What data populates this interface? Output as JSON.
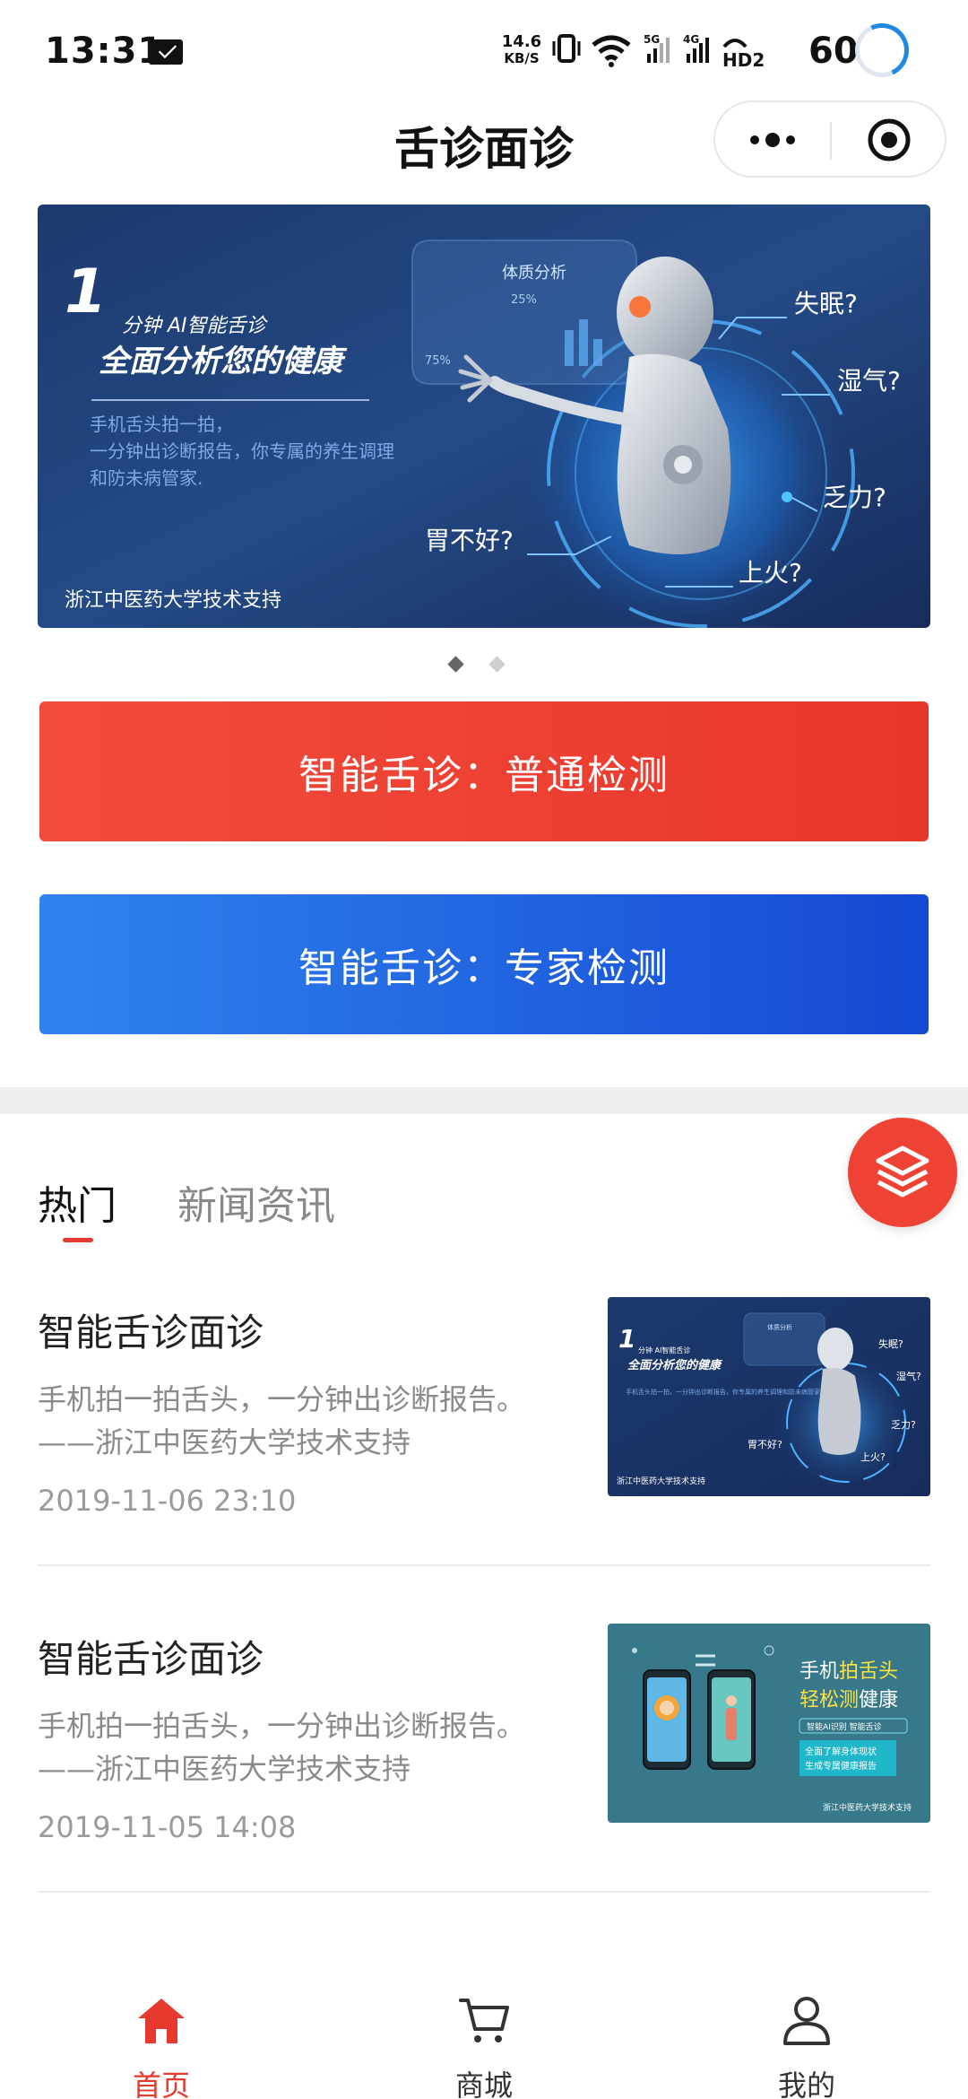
{
  "status_bar": {
    "time": "13:31",
    "net_speed_value": "14.6",
    "net_speed_unit": "KB/S",
    "signal_5g": "5G",
    "signal_4g": "4G",
    "hd_label": "HD2",
    "battery": "60",
    "icons": [
      "mail-icon",
      "vibrate-icon",
      "wifi-icon",
      "signal-5g-icon",
      "signal-4g-icon",
      "hd-icon",
      "battery-ring-icon"
    ]
  },
  "header": {
    "title": "舌诊面诊",
    "capsule_icons": [
      "more-dots-icon",
      "close-target-icon"
    ]
  },
  "banner": {
    "badge_number": "1",
    "line1": "分钟 AI智能舌诊",
    "line2": "全面分析您的健康",
    "desc1": "手机舌头拍一拍，",
    "desc2": "一分钟出诊断报告，你专属的养生调理",
    "desc3": "和防未病管家.",
    "panel_title": "体质分析",
    "panel_pct1": "25%",
    "panel_pct2": "75%",
    "q1": "失眠?",
    "q2": "湿气?",
    "q3": "乏力?",
    "q4": "上火?",
    "q5": "胃不好?",
    "footer": "浙江中医药大学技术支持",
    "pages": 2,
    "active_page": 1
  },
  "actions": {
    "normal_label": "智能舌诊：普通检测",
    "expert_label": "智能舌诊：专家检测"
  },
  "fab": {
    "icon": "layers-icon"
  },
  "tabs": [
    {
      "label": "热门",
      "active": true
    },
    {
      "label": "新闻资讯",
      "active": false
    }
  ],
  "articles": [
    {
      "title": "智能舌诊面诊",
      "desc_line1": "手机拍一拍舌头，一分钟出诊断报告。",
      "desc_line2": "——浙江中医药大学技术支持",
      "date": "2019-11-06 23:10",
      "thumb": {
        "line1": "分钟 AI智能舌诊",
        "line2": "全面分析您的健康",
        "desc": "手机舌头拍一拍，一分钟出诊断报告，你专属的养生调理和防未病管家.",
        "panel": "体质分析",
        "q1": "失眠?",
        "q2": "湿气?",
        "q3": "乏力?",
        "q4": "上火?",
        "q5": "胃不好?",
        "footer": "浙江中医药大学技术支持"
      }
    },
    {
      "title": "智能舌诊面诊",
      "desc_line1": "手机拍一拍舌头，一分钟出诊断报告。",
      "desc_line2": "——浙江中医药大学技术支持",
      "date": "2019-11-05 14:08",
      "thumb": {
        "h1_a": "手机",
        "h1_b": "拍舌头",
        "h2_a": "轻松测",
        "h2_b": "健康",
        "tag": "智能AI识别 智能舌诊",
        "box1": "全面了解身体现状",
        "box2": "生成专属健康报告",
        "footer": "浙江中医药大学技术支持"
      }
    }
  ],
  "bottom_nav": [
    {
      "label": "首页",
      "icon": "home-icon",
      "active": true
    },
    {
      "label": "商城",
      "icon": "cart-icon",
      "active": false
    },
    {
      "label": "我的",
      "icon": "user-icon",
      "active": false
    }
  ],
  "colors": {
    "accent_red": "#e53a2d",
    "button_red": "#f24c3d",
    "button_blue": "#1f62e0",
    "banner_navy": "#1d3466"
  }
}
